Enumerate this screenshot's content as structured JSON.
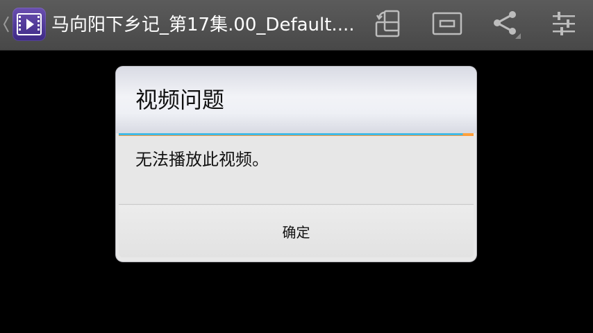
{
  "actionbar": {
    "title": "马向阳下乡记_第17集.00_Default....",
    "icons": [
      "back-caret-icon",
      "video-app-icon",
      "rotate-screen-icon",
      "aspect-ratio-icon",
      "share-icon",
      "settings-sliders-icon"
    ]
  },
  "dialog": {
    "title": "视频问题",
    "message": "无法播放此视频。",
    "ok_label": "确定",
    "accent_color": "#40b8e4",
    "accent_secondary_color": "#ffa13a"
  }
}
